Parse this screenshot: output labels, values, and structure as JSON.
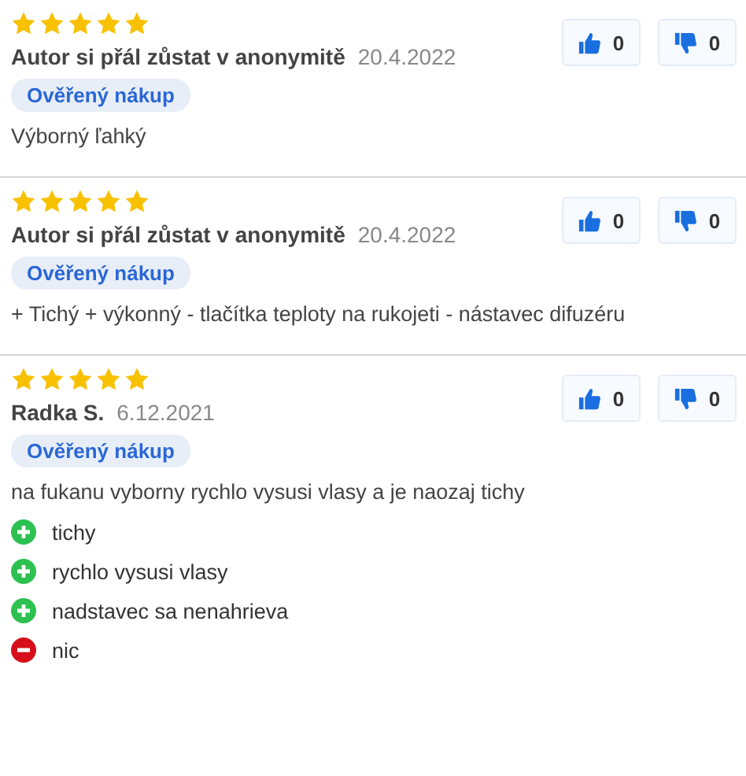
{
  "reviews": [
    {
      "stars": 5,
      "author": "Autor si přál zůstat v anonymitě",
      "date": "20.4.2022",
      "badge": "Ověřený nákup",
      "text": "Výborný ľahký",
      "likes": "0",
      "dislikes": "0"
    },
    {
      "stars": 5,
      "author": "Autor si přál zůstat v anonymitě",
      "date": "20.4.2022",
      "badge": "Ověřený nákup",
      "text": "+ Tichý + výkonný - tlačítka teploty na rukojeti - nástavec difuzéru",
      "likes": "0",
      "dislikes": "0"
    },
    {
      "stars": 5,
      "author": "Radka S.",
      "date": "6.12.2021",
      "badge": "Ověřený nákup",
      "text": "na fukanu vyborny rychlo vysusi vlasy a je naozaj tichy",
      "likes": "0",
      "dislikes": "0",
      "points": [
        {
          "kind": "pro",
          "text": "tichy"
        },
        {
          "kind": "pro",
          "text": "rychlo vysusi vlasy"
        },
        {
          "kind": "pro",
          "text": "nadstavec sa nenahrieva"
        },
        {
          "kind": "con",
          "text": "nic"
        }
      ]
    }
  ]
}
